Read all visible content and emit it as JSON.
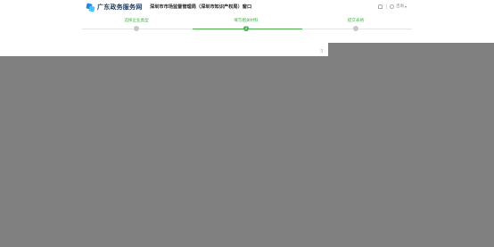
{
  "header": {
    "logo_text": "广东政务服务网",
    "site_title": "深圳市市场监督管理局（深圳市知识产权局）窗口",
    "user_label": "咨询",
    "user_caret": "▾"
  },
  "steps": [
    {
      "label": "选择企业类型",
      "state": "done"
    },
    {
      "label": "填写相关材料",
      "state": "active",
      "number": "2"
    },
    {
      "label": "提交表格",
      "state": "todo"
    }
  ],
  "colors": {
    "accent": "#4caf50",
    "inactive": "#c8c8c8",
    "overlay": "#808080",
    "logo_blue": "#1e88e5"
  },
  "dialog": {
    "handle_glyph": "⠿"
  }
}
